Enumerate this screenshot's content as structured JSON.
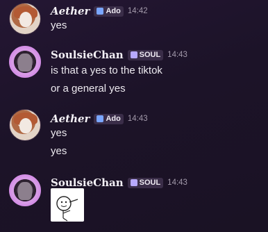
{
  "messages": [
    {
      "author": "Aether",
      "tag": "Ado",
      "time": "14:42",
      "lines": [
        "yes"
      ]
    },
    {
      "author": "SoulsieChan",
      "tag": "SOUL",
      "time": "14:43",
      "lines": [
        "is that a yes to the tiktok",
        "or a general yes"
      ]
    },
    {
      "author": "Aether",
      "tag": "Ado",
      "time": "14:43",
      "lines": [
        "yes",
        "yes"
      ]
    },
    {
      "author": "SoulsieChan",
      "tag": "SOUL",
      "time": "14:43",
      "attachment": "sticker"
    }
  ],
  "icons": {
    "avatar_1": "aether-avatar",
    "avatar_2": "soulsie-avatar",
    "ado_tag": "clan-ado-icon",
    "soul_tag": "clan-soul-icon",
    "sticker": "sticker-image"
  },
  "colors": {
    "background": "#1f142b",
    "tag_bg": "#3a2d48",
    "timestamp": "#a39aab",
    "text": "#ece9ef",
    "soul_avatar_ring": "#d48fe6"
  }
}
